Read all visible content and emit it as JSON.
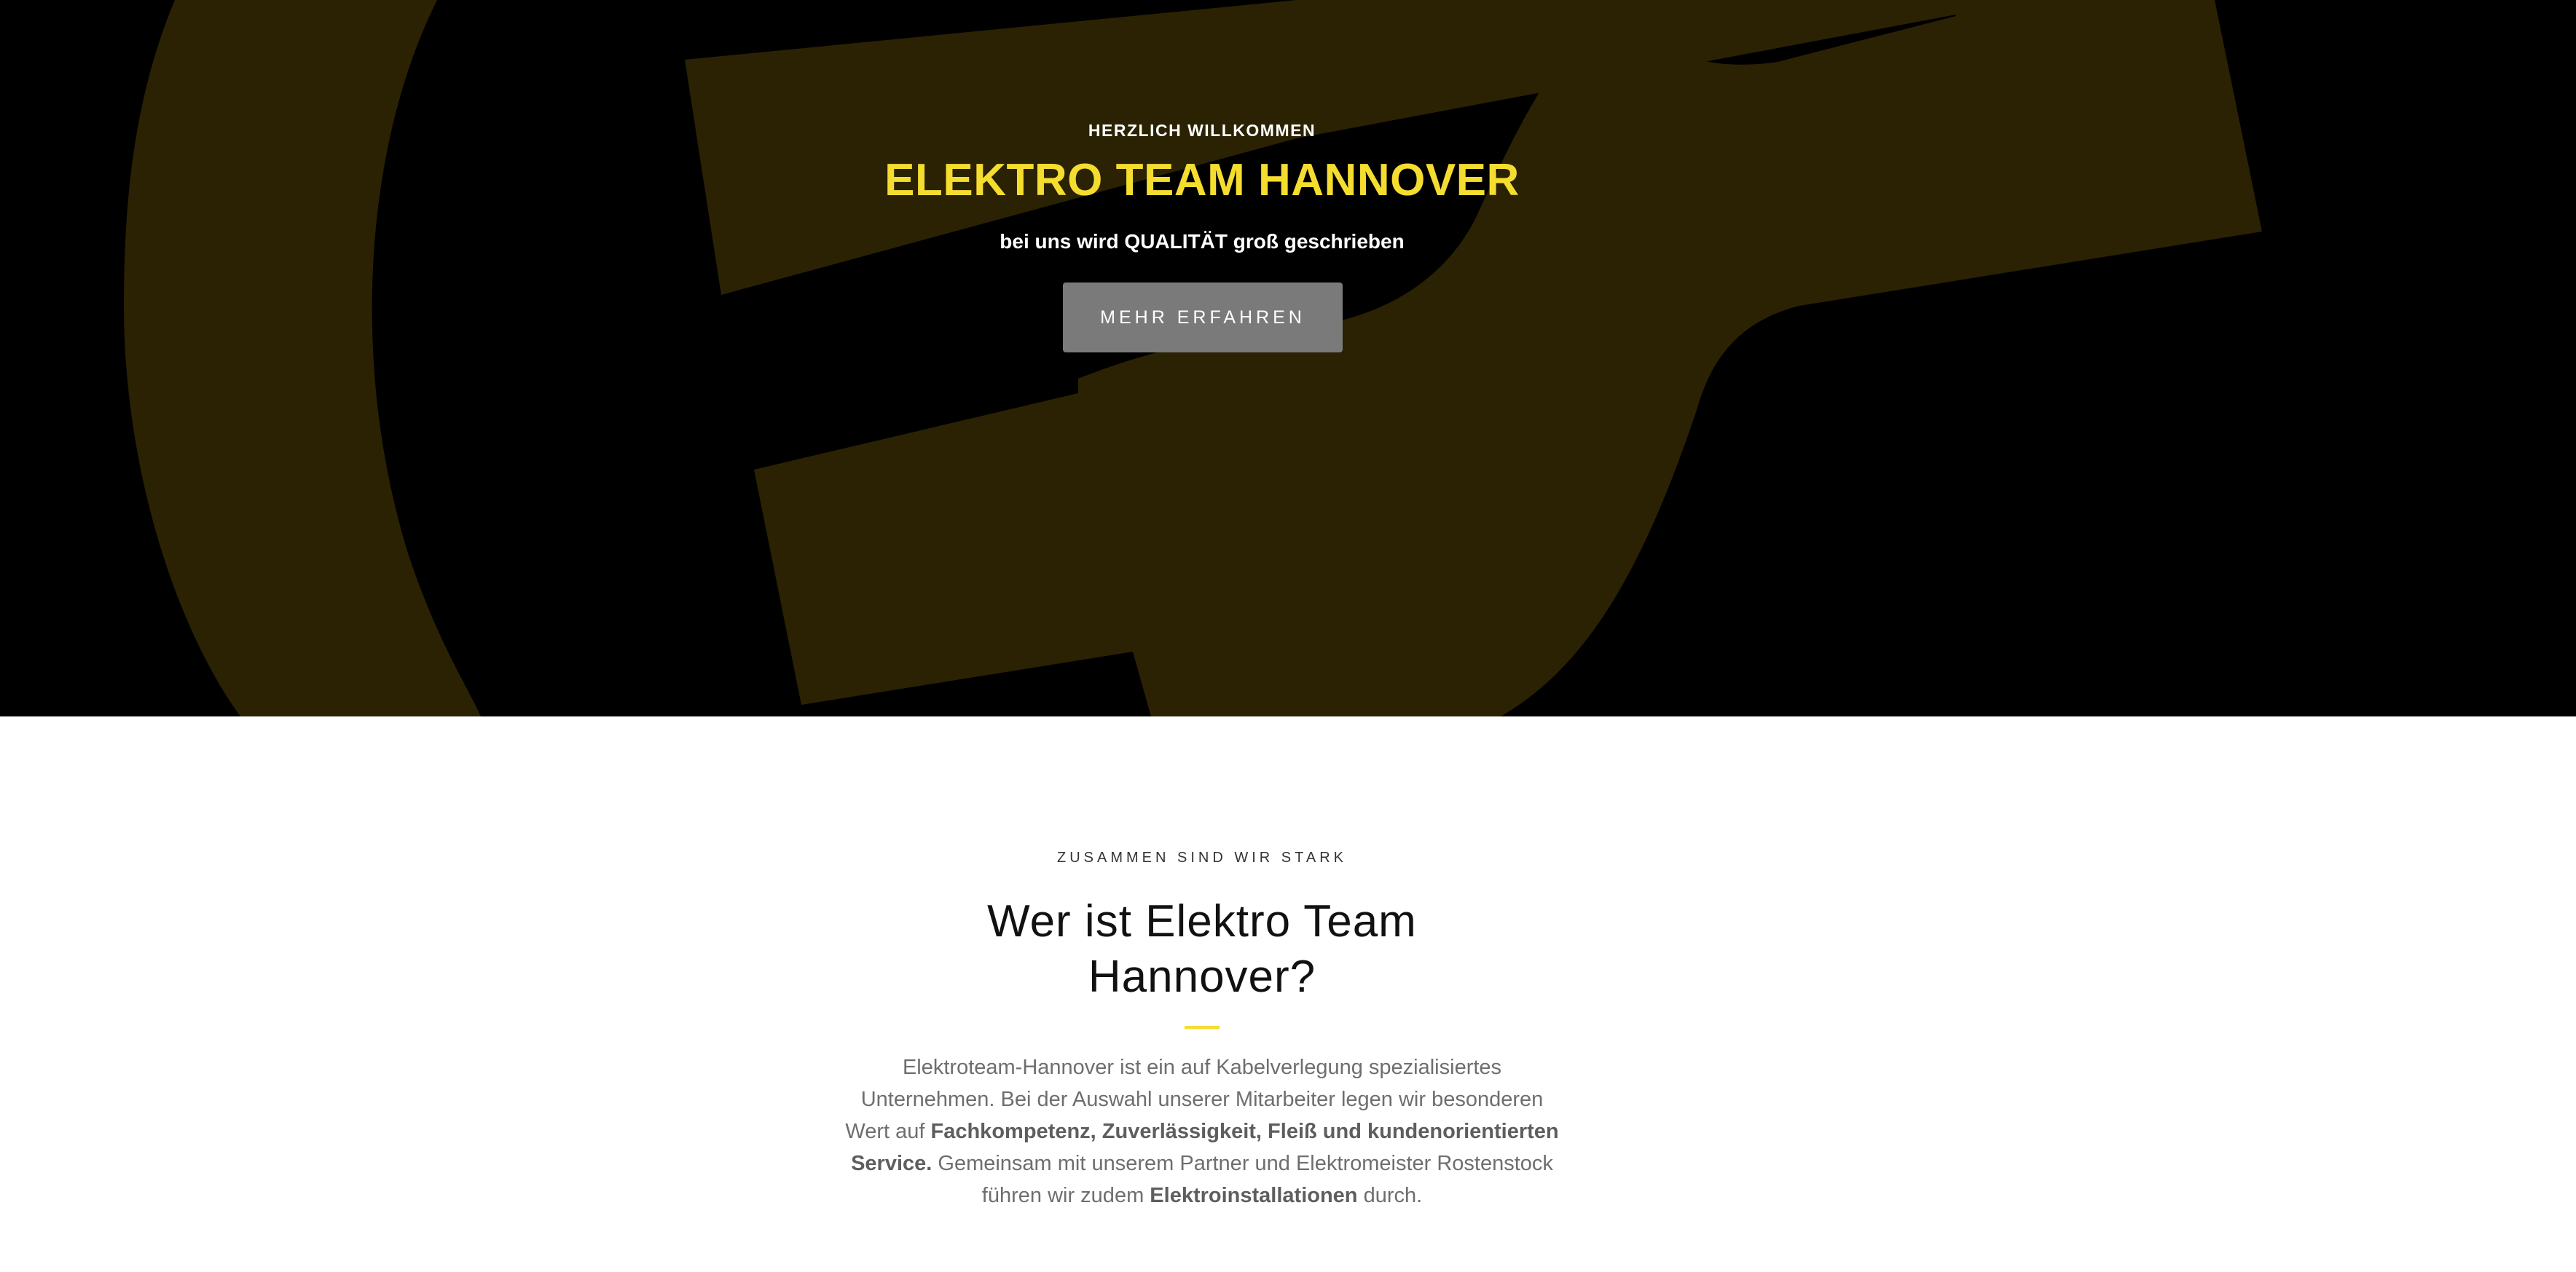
{
  "hero": {
    "eyebrow": "HERZLICH WILLKOMMEN",
    "title": "ELEKTRO TEAM HANNOVER",
    "subtitle": "bei uns wird QUALITÄT groß geschrieben",
    "button_label": "MEHR ERFAHREN",
    "background_color": "#000000",
    "accent_color": "#f5dd2f",
    "background_graphic": "plug-icon"
  },
  "about": {
    "eyebrow": "ZUSAMMEN SIND WIR STARK",
    "title": "Wer ist Elektro Team Hannover?",
    "paragraph": {
      "part1": "Elektroteam-Hannover ist ein auf Kabelverlegung spezialisiertes Unternehmen. Bei der Auswahl unserer Mitarbeiter legen wir besonderen Wert auf ",
      "bold1": "Fachkompetenz, Zuverlässigkeit, Fleiß und kundenorientierten Service.",
      "part2": " Gemeinsam mit unserem Partner und Elektromeister Rostenstock führen wir zudem ",
      "bold2": "Elektroinstallationen",
      "part3": " durch."
    },
    "divider_color": "#f5dd2f"
  }
}
